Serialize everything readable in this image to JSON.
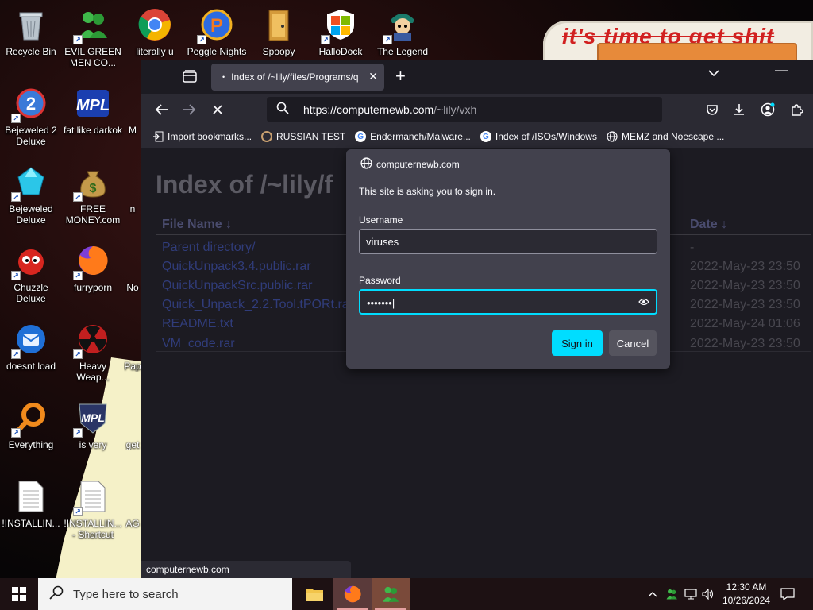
{
  "desktop": {
    "wallpaper_text": "it's time to get shit",
    "icons": [
      {
        "name": "recycle-bin",
        "label": "Recycle Bin"
      },
      {
        "name": "evil-green-men",
        "label": "EVIL GREEN MEN CO..."
      },
      {
        "name": "chrome-literally",
        "label": "literally u"
      },
      {
        "name": "peggle-nights",
        "label": "Peggle Nights"
      },
      {
        "name": "spoopy",
        "label": "Spoopy"
      },
      {
        "name": "hallodock",
        "label": "HalloDock"
      },
      {
        "name": "the-legend",
        "label": "The Legend"
      },
      {
        "name": "bejeweled-2",
        "label": "Bejeweled 2 Deluxe"
      },
      {
        "name": "fat-like-darkok",
        "label": "fat like darkok"
      },
      {
        "name": "m-partial",
        "label": "M"
      },
      {
        "name": "bejeweled-deluxe",
        "label": "Bejeweled Deluxe"
      },
      {
        "name": "free-money",
        "label": "FREE MONEY.com"
      },
      {
        "name": "n-partial",
        "label": "n"
      },
      {
        "name": "chuzzle-deluxe",
        "label": "Chuzzle Deluxe"
      },
      {
        "name": "furryporn",
        "label": "furryporn"
      },
      {
        "name": "no-partial",
        "label": "No"
      },
      {
        "name": "doesnt-load",
        "label": "doesnt load"
      },
      {
        "name": "heavy-weapon",
        "label": "Heavy Weap..."
      },
      {
        "name": "pap-partial",
        "label": "Pap"
      },
      {
        "name": "everything",
        "label": "Everything"
      },
      {
        "name": "is-very",
        "label": "is very"
      },
      {
        "name": "get-partial",
        "label": "get"
      },
      {
        "name": "installin-1",
        "label": "!INSTALLIN..."
      },
      {
        "name": "installin-shortcut",
        "label": "!INSTALLIN... - Shortcut"
      },
      {
        "name": "ag-partial",
        "label": "AG"
      }
    ]
  },
  "browser": {
    "tab_title": "Index of /~lily/files/Programs/q",
    "url_host": "https://computernewb.com",
    "url_path": "/~lily/vxh",
    "bookmarks": [
      "Import bookmarks...",
      "RUSSIAN TEST",
      "Endermanch/Malware...",
      "Index of /ISOs/Windows",
      "MEMZ and Noescape ..."
    ],
    "page_heading": "Index of /~lily/f",
    "columns": {
      "name": "File Name  ↓",
      "date": "Date  ↓"
    },
    "files": [
      {
        "name": "Parent directory/",
        "date": "-"
      },
      {
        "name": "QuickUnpack3.4.public.rar",
        "date": "2022-May-23 23:50"
      },
      {
        "name": "QuickUnpackSrc.public.rar",
        "date": "2022-May-23 23:50"
      },
      {
        "name": "Quick_Unpack_2.2.Tool.tPORt.rar",
        "date": "2022-May-23 23:50"
      },
      {
        "name": "README.txt",
        "date": "2022-May-24 01:06"
      },
      {
        "name": "VM_code.rar",
        "date": "2022-May-23 23:50"
      }
    ],
    "status_url": "computernewb.com"
  },
  "auth_dialog": {
    "site": "computernewb.com",
    "message": "This site is asking you to sign in.",
    "username_label": "Username",
    "username_value": "viruses",
    "password_label": "Password",
    "password_value": "•••••••",
    "signin_label": "Sign in",
    "cancel_label": "Cancel"
  },
  "taskbar": {
    "search_placeholder": "Type here to search",
    "time": "12:30 AM",
    "date": "10/26/2024"
  },
  "colors": {
    "accent": "#00ddff",
    "browser_bg": "#1c1b22",
    "toolbar": "#2b2a33",
    "dialog": "#42414d"
  }
}
